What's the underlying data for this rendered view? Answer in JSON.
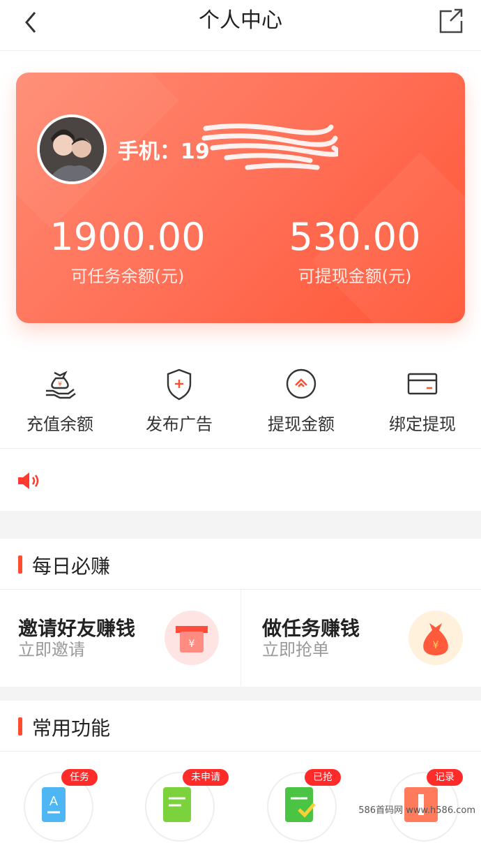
{
  "header": {
    "title": "个人中心"
  },
  "profile": {
    "phone_label": "手机：19"
  },
  "balances": [
    {
      "value": "1900.00",
      "label": "可任务余额(元)"
    },
    {
      "value": "530.00",
      "label": "可提现金额(元)"
    }
  ],
  "actions": [
    {
      "label": "充值余额",
      "icon": "money-bag-hand-icon"
    },
    {
      "label": "发布广告",
      "icon": "shield-plus-icon"
    },
    {
      "label": "提现金额",
      "icon": "coin-icon"
    },
    {
      "label": "绑定提现",
      "icon": "card-icon"
    }
  ],
  "daily": {
    "title": "每日必赚",
    "items": [
      {
        "title": "邀请好友赚钱",
        "sub": "立即邀请"
      },
      {
        "title": "做任务赚钱",
        "sub": "立即抢单"
      }
    ]
  },
  "functions": {
    "title": "常用功能",
    "items": [
      {
        "badge": "任务"
      },
      {
        "badge": "未申请"
      },
      {
        "badge": "已抢"
      },
      {
        "badge": "记录"
      }
    ]
  },
  "watermark": "586首码网 www.h586.com",
  "colors": {
    "accent": "#ff4d2e",
    "card": "#ff6e55"
  }
}
